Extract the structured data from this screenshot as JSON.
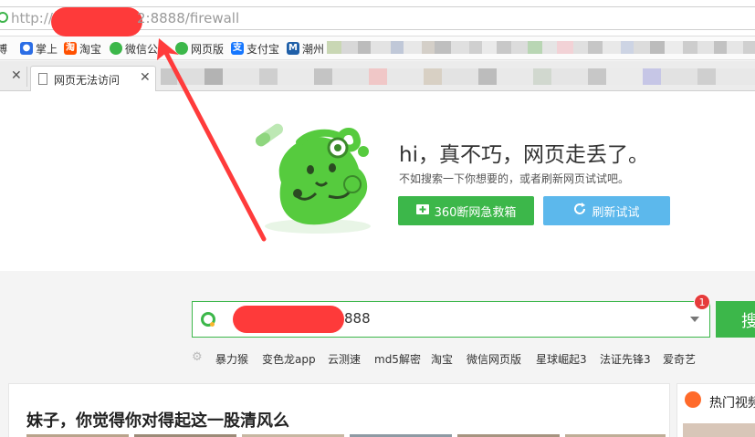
{
  "address_bar": {
    "scheme_text": "http://",
    "path_text": "2:8888/firewall",
    "redaction_color": "#fe3a3a"
  },
  "bookmarks": [
    {
      "label": "博",
      "icon": "weibo-icon",
      "color": "#e6162d"
    },
    {
      "label": "掌上",
      "icon": "paw-icon",
      "color": "#2b6de5"
    },
    {
      "label": "淘宝",
      "icon": "taobao-icon",
      "color": "#ff5000"
    },
    {
      "label": "微信公",
      "icon": "wechat-icon",
      "color": "#3cb74a"
    },
    {
      "label": "网页版",
      "icon": "wechat-web-icon",
      "color": "#3cb74a"
    },
    {
      "label": "支付宝",
      "icon": "alipay-icon",
      "color": "#1677ff"
    },
    {
      "label": "潮州",
      "icon": "m-logo-icon",
      "color": "#1f5fa8"
    }
  ],
  "tabs": {
    "active_title": "网页无法访问"
  },
  "error_page": {
    "title": "hi，真不巧，网页走丢了。",
    "subtitle": "不如搜索一下你想要的，或者刷新网页试试吧。",
    "rescue_button": "360断网急救箱",
    "refresh_button": "刷新试试",
    "accent_green": "#3cb74a",
    "accent_blue": "#5cb8ec"
  },
  "search": {
    "value_visible": "888",
    "badge_count": "1",
    "button_label": "搜",
    "hotwords": [
      "暴力猴",
      "变色龙app",
      "云测速",
      "md5解密",
      "淘宝",
      "微信网页版",
      "星球崛起3",
      "法证先锋3",
      "爱奇艺"
    ]
  },
  "feed": {
    "headline": "妹子，你觉得你对得起这一股清风么",
    "side_title": "热门视频"
  }
}
